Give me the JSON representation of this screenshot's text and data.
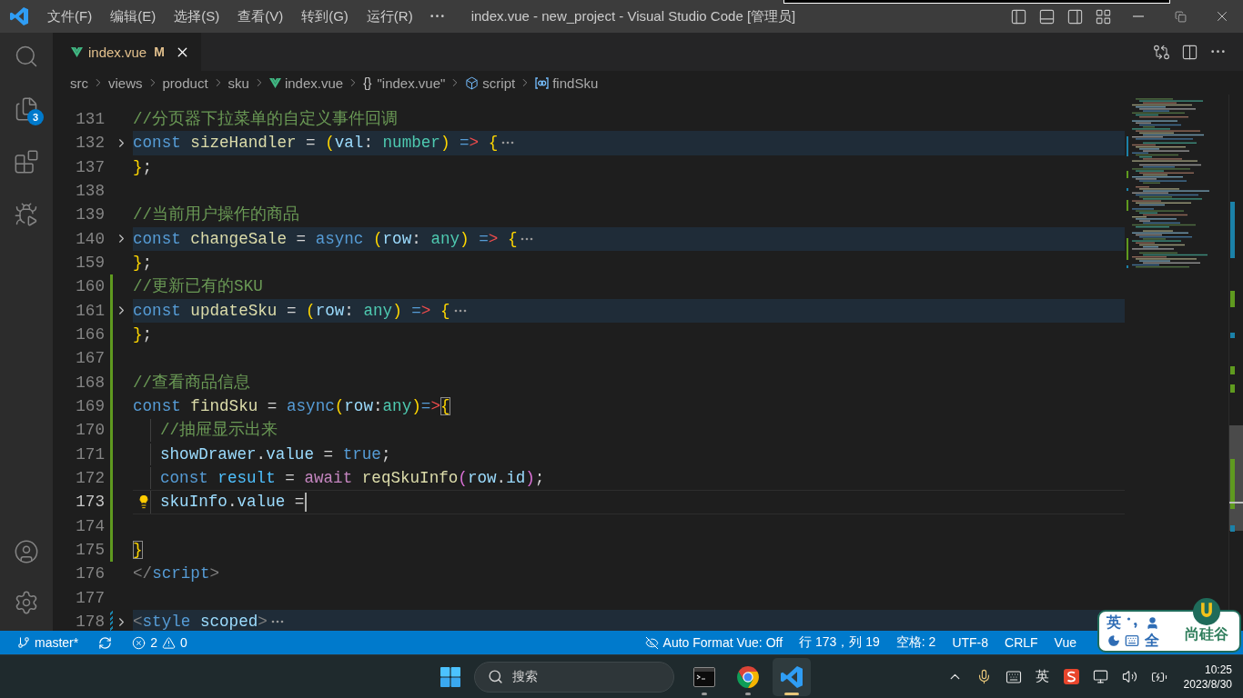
{
  "title_bar": {
    "menus": [
      "文件(F)",
      "编辑(E)",
      "选择(S)",
      "查看(V)",
      "转到(G)",
      "运行(R)"
    ],
    "title": "index.vue - new_project - Visual Studio Code [管理员]"
  },
  "activity_bar": {
    "top": [
      {
        "kind": "search",
        "selected": false
      },
      {
        "kind": "explorer",
        "selected": false,
        "badge": "3"
      },
      {
        "kind": "extensions",
        "selected": false
      },
      {
        "kind": "run",
        "selected": false
      }
    ],
    "bottom": [
      {
        "kind": "account"
      },
      {
        "kind": "settings"
      }
    ]
  },
  "tabs": [
    {
      "label": "index.vue",
      "status": "M",
      "selected": true
    }
  ],
  "breadcrumb": [
    {
      "kind": "folder",
      "label": "src"
    },
    {
      "kind": "folder",
      "label": "views"
    },
    {
      "kind": "folder",
      "label": "product"
    },
    {
      "kind": "folder",
      "label": "sku"
    },
    {
      "kind": "vue-file",
      "label": "index.vue"
    },
    {
      "kind": "object",
      "symbol": "{}",
      "label": "\"index.vue\""
    },
    {
      "kind": "module",
      "label": "script"
    },
    {
      "kind": "variable",
      "label": "findSku"
    }
  ],
  "editor": {
    "lines": [
      {
        "number": "131",
        "folded": false,
        "current": false,
        "indented": false,
        "lightbulb": false,
        "added": false,
        "modified": false,
        "tokens": [
          {
            "text": "//分页器下拉菜单的自定义事件回调",
            "kind": "comment"
          }
        ]
      },
      {
        "number": "132",
        "folded": true,
        "current": false,
        "indented": false,
        "lightbulb": false,
        "added": false,
        "modified": false,
        "tokens": [
          {
            "text": "const ",
            "kind": "keyword"
          },
          {
            "text": "sizeHandler",
            "kind": "function"
          },
          {
            "text": " = ",
            "kind": "plain"
          },
          {
            "text": "(",
            "kind": "bracket1"
          },
          {
            "text": "val",
            "kind": "variable"
          },
          {
            "text": ": ",
            "kind": "plain"
          },
          {
            "text": "number",
            "kind": "type"
          },
          {
            "text": ")",
            "kind": "bracket1"
          },
          {
            "text": " =",
            "kind": "arrow"
          },
          {
            "text": "> ",
            "kind": "arrow_head"
          },
          {
            "text": "{",
            "kind": "bracket1"
          }
        ]
      },
      {
        "number": "137",
        "folded": false,
        "current": false,
        "indented": false,
        "lightbulb": false,
        "added": false,
        "modified": false,
        "tokens": [
          {
            "text": "}",
            "kind": "bracket1"
          },
          {
            "text": ";",
            "kind": "plain"
          }
        ]
      },
      {
        "number": "138",
        "folded": false,
        "current": false,
        "indented": false,
        "lightbulb": false,
        "added": false,
        "modified": false
      },
      {
        "number": "139",
        "folded": false,
        "current": false,
        "indented": false,
        "lightbulb": false,
        "added": false,
        "modified": false,
        "tokens": [
          {
            "text": "//当前用户操作的商品",
            "kind": "comment"
          }
        ]
      },
      {
        "number": "140",
        "folded": true,
        "current": false,
        "indented": false,
        "lightbulb": false,
        "added": false,
        "modified": false,
        "tokens": [
          {
            "text": "const ",
            "kind": "keyword"
          },
          {
            "text": "changeSale",
            "kind": "function"
          },
          {
            "text": " = ",
            "kind": "plain"
          },
          {
            "text": "async ",
            "kind": "keyword"
          },
          {
            "text": "(",
            "kind": "bracket1"
          },
          {
            "text": "row",
            "kind": "variable"
          },
          {
            "text": ": ",
            "kind": "plain"
          },
          {
            "text": "any",
            "kind": "type"
          },
          {
            "text": ")",
            "kind": "bracket1"
          },
          {
            "text": " =",
            "kind": "arrow"
          },
          {
            "text": "> ",
            "kind": "arrow_head"
          },
          {
            "text": "{",
            "kind": "bracket1"
          }
        ]
      },
      {
        "number": "159",
        "folded": false,
        "current": false,
        "indented": false,
        "lightbulb": false,
        "added": false,
        "modified": false,
        "tokens": [
          {
            "text": "}",
            "kind": "bracket1"
          },
          {
            "text": ";",
            "kind": "plain"
          }
        ]
      },
      {
        "number": "160",
        "folded": false,
        "current": false,
        "indented": false,
        "lightbulb": false,
        "added": true,
        "modified": false,
        "tokens": [
          {
            "text": "//更新已有的SKU",
            "kind": "comment"
          }
        ]
      },
      {
        "number": "161",
        "folded": true,
        "current": false,
        "indented": false,
        "lightbulb": false,
        "added": true,
        "modified": false,
        "tokens": [
          {
            "text": "const ",
            "kind": "keyword"
          },
          {
            "text": "updateSku",
            "kind": "function"
          },
          {
            "text": " = ",
            "kind": "plain"
          },
          {
            "text": "(",
            "kind": "bracket1"
          },
          {
            "text": "row",
            "kind": "variable"
          },
          {
            "text": ": ",
            "kind": "plain"
          },
          {
            "text": "any",
            "kind": "type"
          },
          {
            "text": ")",
            "kind": "bracket1"
          },
          {
            "text": " =",
            "kind": "arrow"
          },
          {
            "text": "> ",
            "kind": "arrow_head"
          },
          {
            "text": "{",
            "kind": "bracket1"
          }
        ]
      },
      {
        "number": "166",
        "folded": false,
        "current": false,
        "indented": false,
        "lightbulb": false,
        "added": true,
        "modified": false,
        "tokens": [
          {
            "text": "}",
            "kind": "bracket1"
          },
          {
            "text": ";",
            "kind": "plain"
          }
        ]
      },
      {
        "number": "167",
        "folded": false,
        "current": false,
        "indented": false,
        "lightbulb": false,
        "added": true,
        "modified": false
      },
      {
        "number": "168",
        "folded": false,
        "current": false,
        "indented": false,
        "lightbulb": false,
        "added": true,
        "modified": false,
        "tokens": [
          {
            "text": "//查看商品信息",
            "kind": "comment"
          }
        ]
      },
      {
        "number": "169",
        "folded": false,
        "current": false,
        "indented": false,
        "lightbulb": false,
        "added": true,
        "modified": false,
        "tokens": [
          {
            "text": "const ",
            "kind": "keyword"
          },
          {
            "text": "findSku",
            "kind": "function"
          },
          {
            "text": " = ",
            "kind": "plain"
          },
          {
            "text": "async",
            "kind": "keyword"
          },
          {
            "text": "(",
            "kind": "bracket1"
          },
          {
            "text": "row",
            "kind": "variable"
          },
          {
            "text": ":",
            "kind": "plain"
          },
          {
            "text": "any",
            "kind": "type"
          },
          {
            "text": ")",
            "kind": "bracket1"
          },
          {
            "text": "=",
            "kind": "arrow"
          },
          {
            "text": ">",
            "kind": "arrow_head"
          },
          {
            "text": "{",
            "kind": "bracket1",
            "matched": true
          }
        ]
      },
      {
        "number": "170",
        "folded": false,
        "current": false,
        "indented": true,
        "lightbulb": false,
        "added": true,
        "modified": false,
        "tokens": [
          {
            "text": "//抽屉显示出来",
            "kind": "comment"
          }
        ]
      },
      {
        "number": "171",
        "folded": false,
        "current": false,
        "indented": true,
        "lightbulb": false,
        "added": true,
        "modified": false,
        "tokens": [
          {
            "text": "showDrawer",
            "kind": "variable"
          },
          {
            "text": ".",
            "kind": "plain"
          },
          {
            "text": "value",
            "kind": "variable"
          },
          {
            "text": " = ",
            "kind": "plain"
          },
          {
            "text": "true",
            "kind": "keyword"
          },
          {
            "text": ";",
            "kind": "plain"
          }
        ]
      },
      {
        "number": "172",
        "folded": false,
        "current": false,
        "indented": true,
        "lightbulb": false,
        "added": true,
        "modified": false,
        "tokens": [
          {
            "text": "const ",
            "kind": "keyword"
          },
          {
            "text": "result",
            "kind": "constant"
          },
          {
            "text": " = ",
            "kind": "plain"
          },
          {
            "text": "await ",
            "kind": "control"
          },
          {
            "text": "reqSkuInfo",
            "kind": "function"
          },
          {
            "text": "(",
            "kind": "bracket2"
          },
          {
            "text": "row",
            "kind": "variable"
          },
          {
            "text": ".",
            "kind": "plain"
          },
          {
            "text": "id",
            "kind": "variable"
          },
          {
            "text": ")",
            "kind": "bracket2"
          },
          {
            "text": ";",
            "kind": "plain"
          }
        ]
      },
      {
        "number": "173",
        "folded": false,
        "current": true,
        "indented": true,
        "lightbulb": true,
        "added": true,
        "modified": false,
        "tokens": [
          {
            "text": "skuInfo",
            "kind": "variable"
          },
          {
            "text": ".",
            "kind": "plain"
          },
          {
            "text": "value",
            "kind": "variable"
          },
          {
            "text": " =",
            "kind": "plain"
          }
        ]
      },
      {
        "number": "174",
        "folded": false,
        "current": false,
        "indented": false,
        "lightbulb": false,
        "added": true,
        "modified": false
      },
      {
        "number": "175",
        "folded": false,
        "current": false,
        "indented": false,
        "lightbulb": false,
        "added": true,
        "modified": false,
        "tokens": [
          {
            "text": "}",
            "kind": "bracket1",
            "matched": true
          }
        ]
      },
      {
        "number": "176",
        "folded": false,
        "current": false,
        "indented": false,
        "lightbulb": false,
        "added": false,
        "modified": false,
        "tokens": [
          {
            "text": "</",
            "kind": "tag_punct"
          },
          {
            "text": "script",
            "kind": "tag"
          },
          {
            "text": ">",
            "kind": "tag_punct"
          }
        ]
      },
      {
        "number": "177",
        "folded": false,
        "current": false,
        "indented": false,
        "lightbulb": false,
        "added": false,
        "modified": false
      },
      {
        "number": "178",
        "folded": true,
        "current": false,
        "indented": false,
        "lightbulb": false,
        "added": false,
        "modified": true,
        "tokens": [
          {
            "text": "<",
            "kind": "tag_punct"
          },
          {
            "text": "style ",
            "kind": "tag"
          },
          {
            "text": "scoped",
            "kind": "attribute"
          },
          {
            "text": ">",
            "kind": "tag_punct"
          }
        ]
      }
    ]
  },
  "status_bar": {
    "branch": "master*",
    "errors": "2",
    "warnings": "0",
    "items": [
      {
        "kind": "format",
        "label": "Auto Format Vue: Off"
      },
      {
        "kind": "text",
        "label": "行 173，列 19"
      },
      {
        "kind": "text",
        "label": "空格: 2"
      },
      {
        "kind": "text",
        "label": "UTF-8"
      },
      {
        "kind": "text",
        "label": "CRLF"
      },
      {
        "kind": "text",
        "label": "Vue"
      }
    ]
  },
  "ime_bar": {
    "language": "英",
    "width": "全",
    "brand": "尚硅谷"
  },
  "taskbar": {
    "search": "搜索",
    "apps": [
      {
        "kind": "terminal",
        "selected": false
      },
      {
        "kind": "browser",
        "selected": false
      },
      {
        "kind": "editor",
        "selected": true
      }
    ],
    "input_language": "英",
    "time": "10:25",
    "date": "2023/8/30"
  }
}
